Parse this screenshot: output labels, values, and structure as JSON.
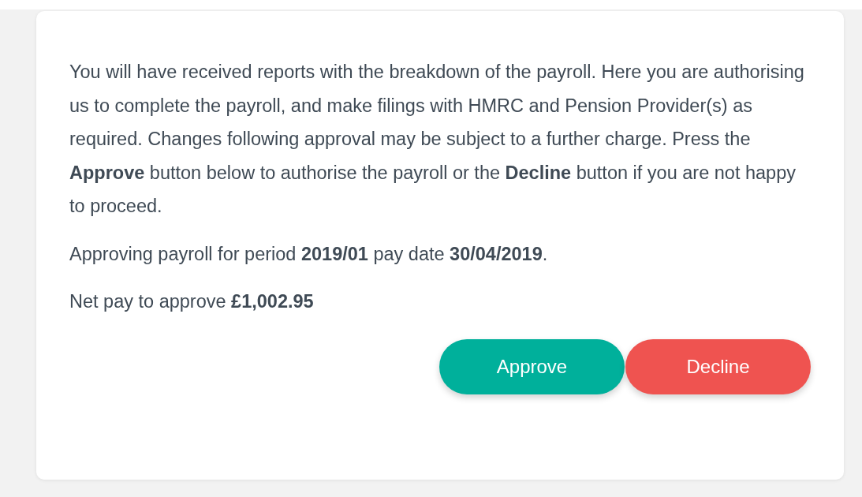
{
  "dialog": {
    "paragraphs": [
      "You will have received reports with the breakdown of the payroll. Here you are authorising us to complete the payroll, and make filings with HMRC and Pension Provider(s) as required. Changes following approval may be subject to a further charge. Press the **Approve** button below to authorise the payroll or the **Decline** button if you are not happy to proceed.",
      "Approving payroll for period **2019/01** pay date **30/04/2019**.",
      "Net pay to approve **£1,002.95**"
    ],
    "buttons": [
      {
        "label": "Approve",
        "kind": "approve"
      },
      {
        "label": "Decline",
        "kind": "decline"
      }
    ]
  }
}
